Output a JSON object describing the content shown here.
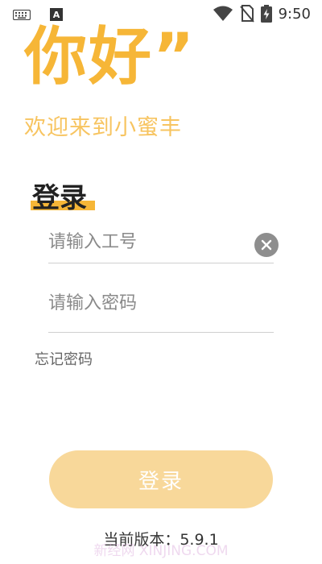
{
  "status_bar": {
    "time": "9:50",
    "left_icons": [
      "keyboard-icon",
      "a-icon"
    ],
    "a_icon_text": "A",
    "right_icons": [
      "wifi-icon",
      "no-sim-icon",
      "battery-charging-icon"
    ]
  },
  "header": {
    "greeting": "你好”",
    "welcome": "欢迎来到小蜜丰"
  },
  "login": {
    "title": "登录",
    "id_placeholder": "请输入工号",
    "password_placeholder": "请输入密码",
    "forgot_password": "忘记密码",
    "submit_label": "登录"
  },
  "footer": {
    "version_label": "当前版本：",
    "version_number": "5.9.1",
    "watermark": "新经网 XINJING.COM"
  },
  "colors": {
    "accent": "#f6b637",
    "button_bg": "#f8d89a",
    "welcome_text": "#f7c460"
  }
}
